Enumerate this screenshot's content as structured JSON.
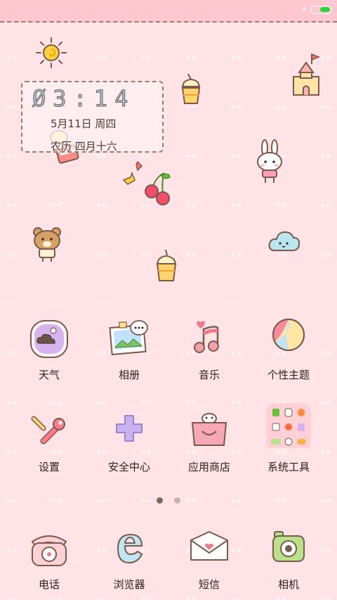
{
  "status_bar": {
    "battery_level": 0.55,
    "battery_color": "#32d23a",
    "charging_icon": "lightning-bolt-icon"
  },
  "clock_widget": {
    "time": "Ø3:14",
    "date": "5月11日 周四",
    "lunar": "农历 四月十六"
  },
  "apps_row1": [
    {
      "label": "天气",
      "icon": "weather-icon"
    },
    {
      "label": "相册",
      "icon": "photo-album-icon"
    },
    {
      "label": "音乐",
      "icon": "music-note-icon"
    },
    {
      "label": "个性主题",
      "icon": "theme-ball-icon"
    }
  ],
  "apps_row2": [
    {
      "label": "设置",
      "icon": "settings-tools-icon"
    },
    {
      "label": "安全中心",
      "icon": "security-plus-icon"
    },
    {
      "label": "应用商店",
      "icon": "app-store-bag-icon"
    },
    {
      "label": "系统工具",
      "icon": "folder-icon"
    }
  ],
  "page_indicator": {
    "pages": 2,
    "current": 1,
    "active_color": "#7b6a57",
    "inactive_color": "#cbb4ae"
  },
  "dock": [
    {
      "label": "电话",
      "icon": "phone-icon"
    },
    {
      "label": "浏览器",
      "icon": "browser-icon"
    },
    {
      "label": "短信",
      "icon": "message-envelope-icon"
    },
    {
      "label": "相机",
      "icon": "camera-icon"
    }
  ],
  "colors": {
    "background": "#ffe3e6",
    "status_bar": "#ffc7cf",
    "text": "#2c1e1c"
  }
}
